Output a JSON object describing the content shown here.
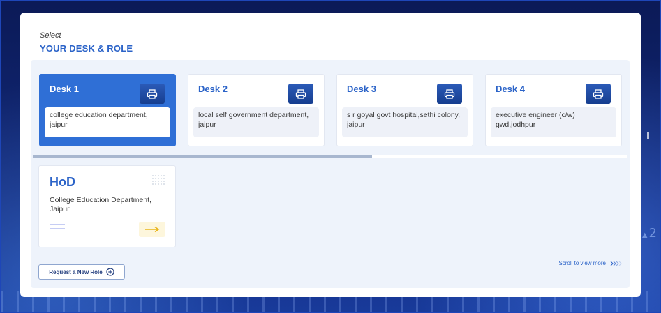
{
  "header": {
    "select_label": "Select",
    "title": "YOUR DESK & ROLE"
  },
  "desks": [
    {
      "name": "Desk 1",
      "description": "college education department, jaipur",
      "active": true,
      "icon": "printer-icon"
    },
    {
      "name": "Desk 2",
      "description": "local self government department, jaipur",
      "active": false,
      "icon": "printer-icon"
    },
    {
      "name": "Desk 3",
      "description": "s r goyal govt hospital,sethi colony, jaipur",
      "active": false,
      "icon": "printer-icon"
    },
    {
      "name": "Desk 4",
      "description": "executive engineer (c/w) gwd,jodhpur",
      "active": false,
      "icon": "printer-icon"
    }
  ],
  "scrollbar": {
    "visible_fraction": 0.57
  },
  "hod": {
    "title": "HoD",
    "description": "College Education Department, Jaipur",
    "arrow_icon": "arrow-right-icon"
  },
  "footer": {
    "request_label": "Request a New Role",
    "scroll_hint": "Scroll to view more"
  },
  "background": {
    "number": "2"
  },
  "colors": {
    "accent": "#2b63c8",
    "active_card": "#2f6fd6",
    "desk_button": "#163e8f",
    "arrow": "#e9b51a"
  }
}
